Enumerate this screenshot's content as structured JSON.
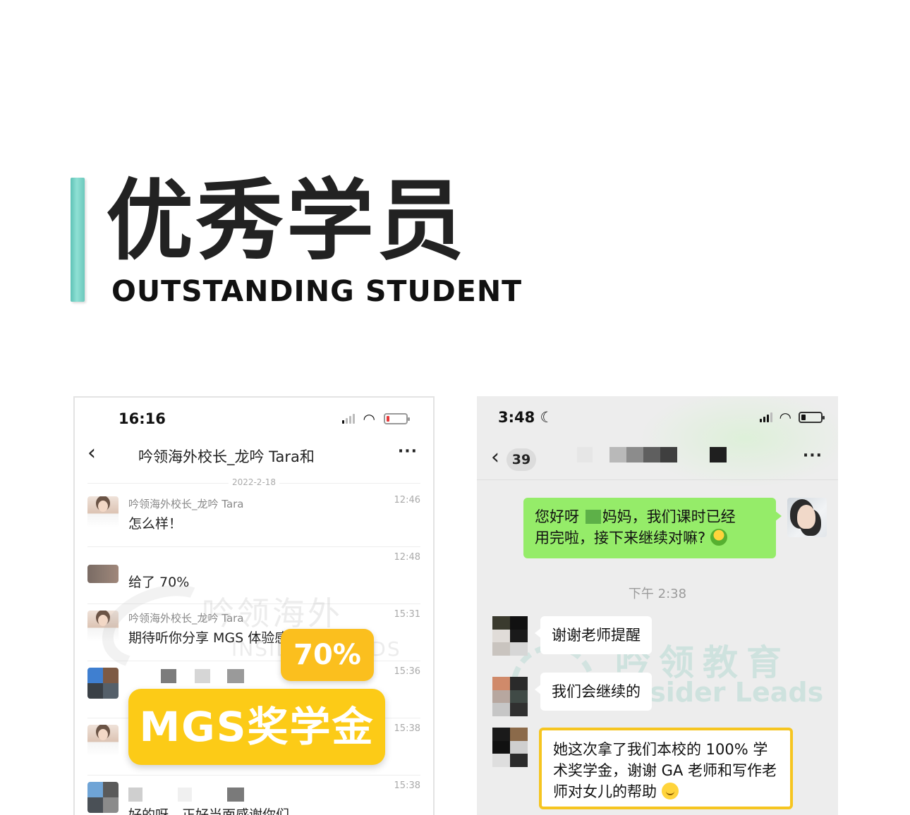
{
  "header": {
    "title_cn": "优秀学员",
    "title_en": "OUTSTANDING STUDENT"
  },
  "colors": {
    "accent_teal": "#6cc9bd",
    "badge_yellow": "#fccb17",
    "wechat_green": "#95ec69",
    "highlight_border": "#f6c520"
  },
  "left_chat": {
    "status_time": "16:16",
    "title": "吟领海外校长_龙吟 Tara和",
    "back_icon": "chevron-left-icon",
    "more_icon": "more-dots-icon",
    "date": "2022-2-18",
    "messages": [
      {
        "name": "吟领海外校长_龙吟 Tara",
        "text": "怎么样！",
        "time": "12:46"
      },
      {
        "name": "",
        "text": "给了 70%",
        "time": "12:48"
      },
      {
        "name": "吟领海外校长_龙吟 Tara",
        "text": "期待听你分享 MGS 体验感了",
        "time": "15:31"
      },
      {
        "name": "",
        "text": "",
        "time": "15:36"
      },
      {
        "name": "",
        "text": "",
        "time": "15:38"
      },
      {
        "name": "",
        "text": "好的呀，正好当面感谢你们",
        "time": "15:38"
      }
    ],
    "watermark": "吟领海外",
    "watermark_sub": "INSIDER LEADS",
    "badge_percent": "70%",
    "badge_scholarship": "MGS奖学金"
  },
  "right_chat": {
    "status_time": "3:48",
    "moon_icon": "moon-icon",
    "back_icon": "chevron-left-icon",
    "unread_count": "39",
    "more_icon": "more-dots-icon",
    "outgoing": {
      "line1_a": "您好呀",
      "line1_b": "妈妈，我们课时已经",
      "line2": "用完啦，接下来继续对嘛?"
    },
    "timestamp": "下午 2:38",
    "incoming": [
      "谢谢老师提醒",
      "我们会继续的",
      "她这次拿了我们本校的 100% 学术奖学金，谢谢 GA 老师和写作老师对女儿的帮助"
    ],
    "watermark": "吟领教育",
    "watermark_sub": "Insider Leads"
  }
}
